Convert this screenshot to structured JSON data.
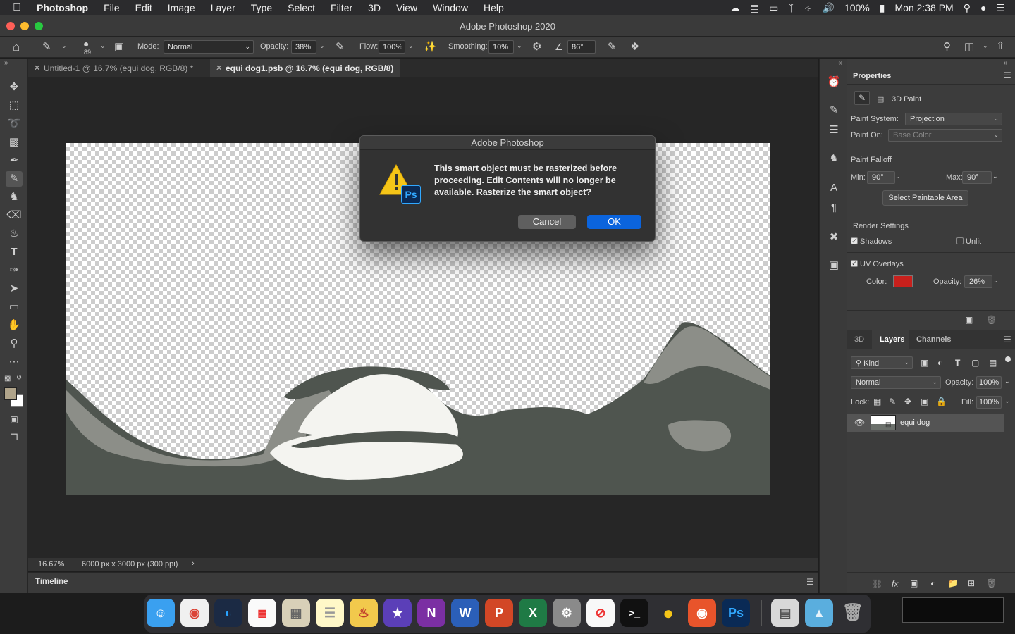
{
  "menubar": {
    "app": "Photoshop",
    "items": [
      "File",
      "Edit",
      "Image",
      "Layer",
      "Type",
      "Select",
      "Filter",
      "3D",
      "View",
      "Window",
      "Help"
    ],
    "battery": "100%",
    "clock": "Mon 2:38 PM"
  },
  "window": {
    "title": "Adobe Photoshop 2020"
  },
  "options": {
    "brush_size": "89",
    "mode_label": "Mode:",
    "mode_value": "Normal",
    "opacity_label": "Opacity:",
    "opacity_value": "38%",
    "flow_label": "Flow:",
    "flow_value": "100%",
    "smoothing_label": "Smoothing:",
    "smoothing_value": "10%",
    "angle_value": "86°"
  },
  "tabs": [
    {
      "label": "Untitled-1 @ 16.7% (equi dog, RGB/8) *",
      "active": false
    },
    {
      "label": "equi dog1.psb @ 16.7% (equi dog, RGB/8)",
      "active": true
    }
  ],
  "status": {
    "zoom": "16.67%",
    "doc_info": "6000 px x 3000 px (300 ppi)",
    "arrow": "›"
  },
  "timeline": {
    "label": "Timeline"
  },
  "dialog": {
    "title": "Adobe Photoshop",
    "message": "This smart object must be rasterized before proceeding.  Edit Contents will no longer be available.  Rasterize the smart object?",
    "cancel": "Cancel",
    "ok": "OK",
    "badge": "Ps"
  },
  "properties": {
    "title": "Properties",
    "subtitle": "3D Paint",
    "paint_system_label": "Paint System:",
    "paint_system_value": "Projection",
    "paint_on_label": "Paint On:",
    "paint_on_value": "Base Color",
    "falloff_title": "Paint Falloff",
    "min_label": "Min:",
    "min_value": "90°",
    "max_label": "Max:",
    "max_value": "90°",
    "select_paintable": "Select Paintable Area",
    "render_settings": "Render Settings",
    "shadows": "Shadows",
    "unlit": "Unlit",
    "uv_overlays": "UV Overlays",
    "color_label": "Color:",
    "uv_color": "#c8201c",
    "opacity_label": "Opacity:",
    "opacity_value": "26%"
  },
  "layers": {
    "tabs": [
      "3D",
      "Layers",
      "Channels"
    ],
    "filter_kind": "Kind",
    "blend_mode": "Normal",
    "opacity_label": "Opacity:",
    "opacity_value": "100%",
    "lock_label": "Lock:",
    "fill_label": "Fill:",
    "fill_value": "100%",
    "layer_name": "equi dog"
  },
  "canvas_colors": {
    "dark": "#4f554f",
    "mid": "#8c8e88",
    "light": "#f4f4f0"
  }
}
